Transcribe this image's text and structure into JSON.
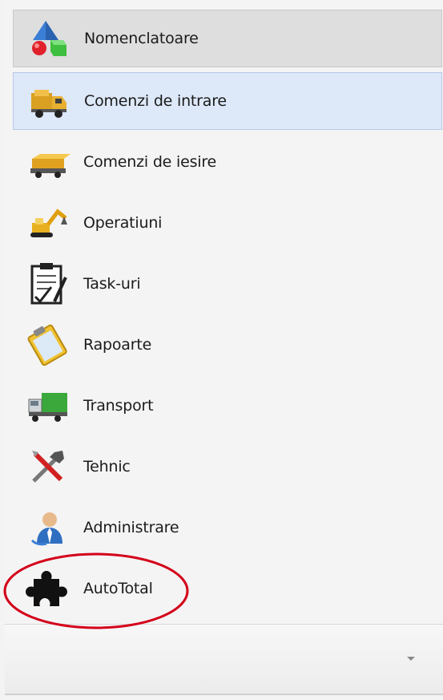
{
  "nav": {
    "items": [
      {
        "label": "Nomenclatoare",
        "icon": "shapes-icon"
      },
      {
        "label": "Comenzi de intrare",
        "icon": "delivery-truck-icon"
      },
      {
        "label": "Comenzi de iesire",
        "icon": "package-pallet-icon"
      },
      {
        "label": "Operatiuni",
        "icon": "excavator-icon"
      },
      {
        "label": "Task-uri",
        "icon": "clipboard-checklist-icon"
      },
      {
        "label": "Rapoarte",
        "icon": "report-clipboard-icon"
      },
      {
        "label": "Transport",
        "icon": "green-truck-icon"
      },
      {
        "label": "Tehnic",
        "icon": "tools-icon"
      },
      {
        "label": "Administrare",
        "icon": "user-icon"
      },
      {
        "label": "AutoTotal",
        "icon": "puzzle-piece-icon"
      }
    ]
  },
  "colors": {
    "header_bg": "#dedede",
    "selected_bg": "#dde8f8",
    "annotation_ellipse": "#d4001a"
  },
  "footer": {
    "dropdown_icon": "chevron-down-icon"
  }
}
